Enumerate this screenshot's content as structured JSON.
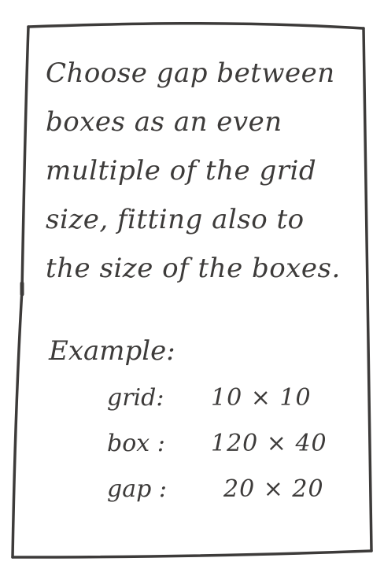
{
  "note": {
    "lines": [
      "Choose gap between",
      "boxes as an even",
      "multiple of the grid",
      "size, fitting also to",
      "the size of the boxes."
    ]
  },
  "example": {
    "heading": "Example:",
    "rows": [
      {
        "label": "grid:",
        "value": "10 × 10"
      },
      {
        "label": "box :",
        "value": "120 × 40"
      },
      {
        "label": "gap :",
        "value": "20 × 20"
      }
    ]
  },
  "colors": {
    "ink": "#3d3b3a",
    "paper": "#ffffff"
  }
}
